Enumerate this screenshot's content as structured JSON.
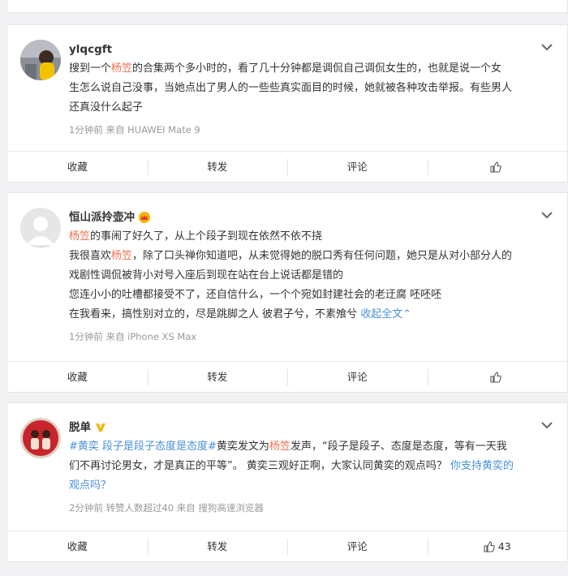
{
  "actions": {
    "collect": "收藏",
    "repost": "转发",
    "comment": "评论"
  },
  "posts": [
    {
      "username": "ylqcgft",
      "text_lines": [
        [
          {
            "t": "搜到一个"
          },
          {
            "t": "杨笠",
            "hl": true
          },
          {
            "t": "的合集两个多小时的，看了几十分钟都是调侃自己调侃女生的，也就是说一个女"
          }
        ],
        [
          {
            "t": "生怎么说自己没事，当她点出了男人的一些些真实面目的时候，她就被各种攻击举报。有些男人"
          }
        ],
        [
          {
            "t": "还真没什么起子"
          }
        ]
      ],
      "meta": "1分钟前  来自 HUAWEI Mate 9",
      "likes": ""
    },
    {
      "username": "恒山派拎壶冲",
      "badge": "crown-icon",
      "text_lines": [
        [
          {
            "t": "杨笠",
            "hl": true
          },
          {
            "t": "的事闹了好久了，从上个段子到现在依然不依不挠"
          }
        ],
        [
          {
            "t": "我很喜欢"
          },
          {
            "t": "杨笠",
            "hl": true
          },
          {
            "t": "，除了口头禅你知道吧，从未觉得她的脱口秀有任何问题，她只是从对小部分人的"
          }
        ],
        [
          {
            "t": "戏剧性调侃被背小对号入座后到现在站在台上说话都是错的"
          }
        ],
        [
          {
            "t": "您连小小的吐槽都接受不了，还自信什么，一个个宛如封建社会的老迂腐 呸呸呸"
          }
        ],
        [
          {
            "t": "在我看来，搞性别对立的，尽是跳脚之人 彼君子兮，不素飧兮 "
          },
          {
            "t": "收起全文",
            "link": true
          },
          {
            "t": "⌃",
            "link": true
          }
        ]
      ],
      "meta": "1分钟前  来自 iPhone XS Max",
      "likes": ""
    },
    {
      "username": "脱单",
      "badge": "verified-v-icon",
      "text_lines": [
        [
          {
            "t": "#黄奕 段子是段子态度是态度#",
            "link": true
          },
          {
            "t": "黄奕发文为"
          },
          {
            "t": "杨笠",
            "hl": true
          },
          {
            "t": "发声，“段子是段子、态度是态度，等有一天我"
          }
        ],
        [
          {
            "t": "们不再讨论男女，才是真正的平等”。 黄奕三观好正啊，大家认同黄奕的观点吗？ "
          },
          {
            "t": "你支持黄奕的",
            "link": true
          }
        ],
        [
          {
            "t": "观点吗？",
            "link": true
          }
        ]
      ],
      "meta": "2分钟前  转赞人数超过40  来自 搜狗高速浏览器",
      "likes": "43"
    }
  ],
  "colors": {
    "highlight": "#eb7350",
    "link": "#4a90d9",
    "bg": "#f2f2f5"
  }
}
